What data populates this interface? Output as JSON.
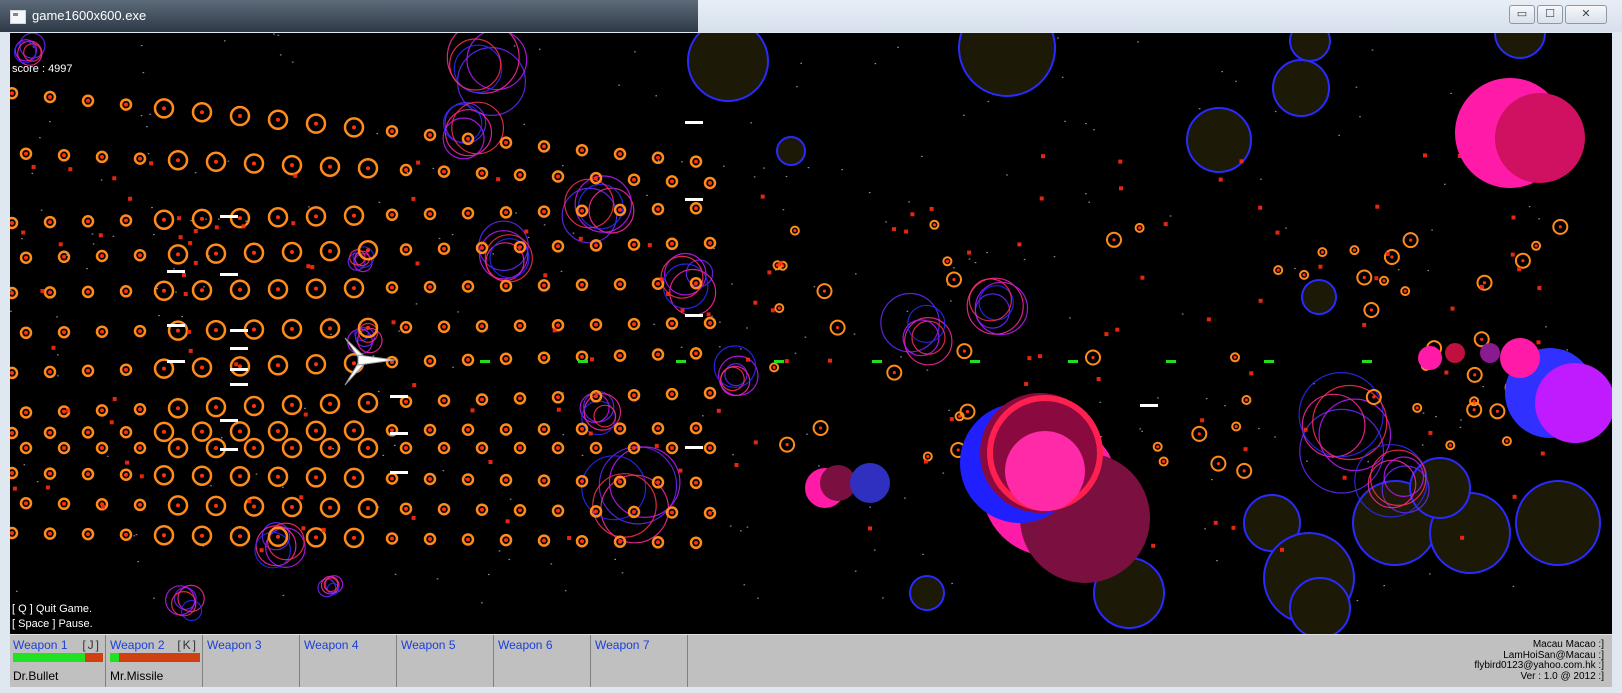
{
  "window": {
    "title": "game1600x600.exe",
    "controls": {
      "minimize": "▭",
      "maximize": "☐",
      "close": "✕"
    }
  },
  "hud": {
    "score": "score : 4997",
    "help_quit": "[ Q ] Quit Game.",
    "help_pause": "[ Space ] Pause."
  },
  "weapons": [
    {
      "name": "Weapon 1",
      "key": "[J]",
      "type": "Dr.Bullet",
      "charge": 0.8
    },
    {
      "name": "Weapon 2",
      "key": "[K]",
      "type": "Mr.Missile",
      "charge": 0.1
    },
    {
      "name": "Weapon 3"
    },
    {
      "name": "Weapon 4"
    },
    {
      "name": "Weapon 5"
    },
    {
      "name": "Weapon 6"
    },
    {
      "name": "Weapon 7"
    }
  ],
  "credits": [
    "Macau Macao :]",
    "LamHoiSan@Macau :]",
    "flybird0123@yahoo.com.hk :]",
    "Ver : 1.0 @ 2012 :]"
  ],
  "colors": {
    "background": "#000000",
    "ring": "#ff8c1a",
    "ring_core": "#ff3010",
    "blue_ring": "#2a2aff",
    "planet_fill": "#1c1a06",
    "magenta": "#ff1aa8",
    "laser": "#ffffff",
    "green_shot": "#22dd22",
    "panel": "#c0c0c0",
    "weapon_label": "#1a3fd8",
    "charge_fill": "#22e022",
    "charge_empty": "#d04010"
  }
}
